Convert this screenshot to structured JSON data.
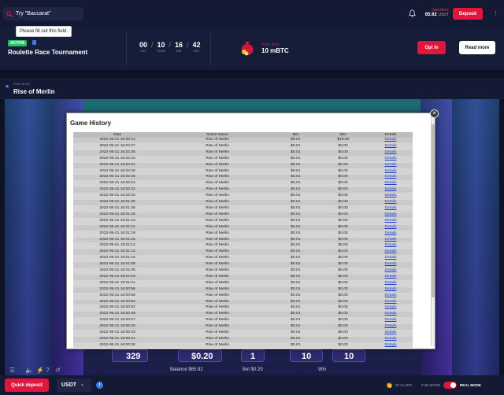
{
  "search": {
    "value": "Try \"Baccarat\"",
    "tooltip": "Please fill out this field."
  },
  "user": {
    "name": "matchbox",
    "balance": "65.92",
    "currency": "USDT"
  },
  "header": {
    "deposit_label": "Deposit"
  },
  "tournament": {
    "status": "ACTIVE",
    "title": "Roulette Race Tournament",
    "countdown": [
      {
        "value": "00",
        "label": "DAY"
      },
      {
        "value": "10",
        "label": "HOUR"
      },
      {
        "value": "16",
        "label": "MIN"
      },
      {
        "value": "42",
        "label": "SEC"
      }
    ],
    "prize_label": "Prize pool",
    "prize_value": "10 mBTC",
    "opt_in_label": "Opt In",
    "read_more_label": "Read more"
  },
  "game": {
    "provider": "PLAY'N GO",
    "title": "Rise of Merlin"
  },
  "controls": {
    "num_left": "329",
    "bet_value": "$0.20",
    "num_mid": "1",
    "num_right1": "10",
    "num_right2": "10",
    "balance_label": "Balance $65.92",
    "bet_label": "Bet $0.20",
    "win_label": "Win"
  },
  "history": {
    "title": "Game History",
    "columns": [
      "Date",
      "Game Name",
      "Bet",
      "Win",
      "Details"
    ],
    "rows": [
      [
        "2022-05-21 16:35:13",
        "Rise of Merlin",
        "$0.01",
        "$18.09",
        "Details"
      ],
      [
        "2022-05-21 16:02:37",
        "Rise of Merlin",
        "$0.01",
        "$0.00",
        "Details"
      ],
      [
        "2022-05-21 16:02:35",
        "Rise of Merlin",
        "$0.01",
        "$0.00",
        "Details"
      ],
      [
        "2022-05-21 16:02:33",
        "Rise of Merlin",
        "$0.01",
        "$0.00",
        "Details"
      ],
      [
        "2022-05-21 16:02:31",
        "Rise of Merlin",
        "$0.01",
        "$0.00",
        "Details"
      ],
      [
        "2022-05-21 16:02:28",
        "Rise of Merlin",
        "$0.01",
        "$0.00",
        "Details"
      ],
      [
        "2022-05-21 16:02:26",
        "Rise of Merlin",
        "$0.01",
        "$0.00",
        "Details"
      ],
      [
        "2022-05-21 16:02:24",
        "Rise of Merlin",
        "$0.01",
        "$0.00",
        "Details"
      ],
      [
        "2022-05-21 16:02:22",
        "Rise of Merlin",
        "$0.01",
        "$0.00",
        "Details"
      ],
      [
        "2022-05-21 16:02:20",
        "Rise of Merlin",
        "$0.01",
        "$0.00",
        "Details"
      ],
      [
        "2022-05-21 16:01:30",
        "Rise of Merlin",
        "$0.01",
        "$0.00",
        "Details"
      ],
      [
        "2022-05-21 16:01:28",
        "Rise of Merlin",
        "$0.01",
        "$0.00",
        "Details"
      ],
      [
        "2022-05-21 16:01:26",
        "Rise of Merlin",
        "$0.01",
        "$0.00",
        "Details"
      ],
      [
        "2022-05-21 16:01:23",
        "Rise of Merlin",
        "$0.01",
        "$0.00",
        "Details"
      ],
      [
        "2022-05-21 16:01:21",
        "Rise of Merlin",
        "$0.01",
        "$0.00",
        "Details"
      ],
      [
        "2022-05-21 16:01:19",
        "Rise of Merlin",
        "$0.01",
        "$0.00",
        "Details"
      ],
      [
        "2022-05-21 16:01:16",
        "Rise of Merlin",
        "$0.01",
        "$0.00",
        "Details"
      ],
      [
        "2022-05-21 16:01:14",
        "Rise of Merlin",
        "$0.01",
        "$0.00",
        "Details"
      ],
      [
        "2022-05-21 16:01:12",
        "Rise of Merlin",
        "$0.01",
        "$0.00",
        "Details"
      ],
      [
        "2022-05-21 16:01:10",
        "Rise of Merlin",
        "$0.01",
        "$0.00",
        "Details"
      ],
      [
        "2022-05-21 16:01:08",
        "Rise of Merlin",
        "$0.01",
        "$0.00",
        "Details"
      ],
      [
        "2022-05-21 16:01:05",
        "Rise of Merlin",
        "$0.01",
        "$0.00",
        "Details"
      ],
      [
        "2022-05-21 16:01:03",
        "Rise of Merlin",
        "$0.01",
        "$0.00",
        "Details"
      ],
      [
        "2022-05-21 16:01:01",
        "Rise of Merlin",
        "$0.01",
        "$0.00",
        "Details"
      ],
      [
        "2022-05-21 16:00:58",
        "Rise of Merlin",
        "$0.01",
        "$0.00",
        "Details"
      ],
      [
        "2022-05-21 16:00:56",
        "Rise of Merlin",
        "$0.01",
        "$0.00",
        "Details"
      ],
      [
        "2022-05-21 16:00:54",
        "Rise of Merlin",
        "$0.01",
        "$0.00",
        "Details"
      ],
      [
        "2022-05-21 16:00:52",
        "Rise of Merlin",
        "$0.01",
        "$0.05",
        "Details"
      ],
      [
        "2022-05-21 16:00:49",
        "Rise of Merlin",
        "$0.01",
        "$0.00",
        "Details"
      ],
      [
        "2022-05-21 16:00:47",
        "Rise of Merlin",
        "$0.01",
        "$0.00",
        "Details"
      ],
      [
        "2022-05-21 16:00:45",
        "Rise of Merlin",
        "$0.01",
        "$0.00",
        "Details"
      ],
      [
        "2022-05-21 16:00:43",
        "Rise of Merlin",
        "$0.01",
        "$0.00",
        "Details"
      ],
      [
        "2022-05-21 16:00:41",
        "Rise of Merlin",
        "$0.01",
        "$0.00",
        "Details"
      ],
      [
        "2022-05-21 16:00:38",
        "Rise of Merlin",
        "$0.01",
        "$0.00",
        "Details"
      ],
      [
        "2022-05-21 16:00:36",
        "Rise of Merlin",
        "$0.01",
        "$0.00",
        "Details"
      ],
      [
        "2022-05-21 16:00:34",
        "Rise of Merlin",
        "$0.01",
        "$0.00",
        "Details"
      ],
      [
        "2022-05-21 16:00:32",
        "Rise of Merlin",
        "$0.01",
        "$0.00",
        "Details"
      ],
      [
        "2022-05-21 16:00:30",
        "Rise of Merlin",
        "$0.01",
        "$0.00",
        "Details"
      ],
      [
        "2022-05-21 16:00:27",
        "Rise of Merlin",
        "$0.01",
        "$0.00",
        "Details"
      ],
      [
        "2022-05-21 16:00:25",
        "Rise of Merlin",
        "$0.01",
        "$0.00",
        "Details"
      ]
    ]
  },
  "footer": {
    "quick_deposit_label": "Quick deposit",
    "currency": "USDT",
    "info_glyph": "i",
    "claps": "22 CLAPS",
    "fun_mode": "FUN MODE",
    "real_mode": "REAL MODE"
  },
  "colors": {
    "accent": "#e0163d",
    "background": "#0e1326",
    "panel": "#141a33",
    "active": "#2ac06a",
    "link": "#1a3ccf"
  }
}
